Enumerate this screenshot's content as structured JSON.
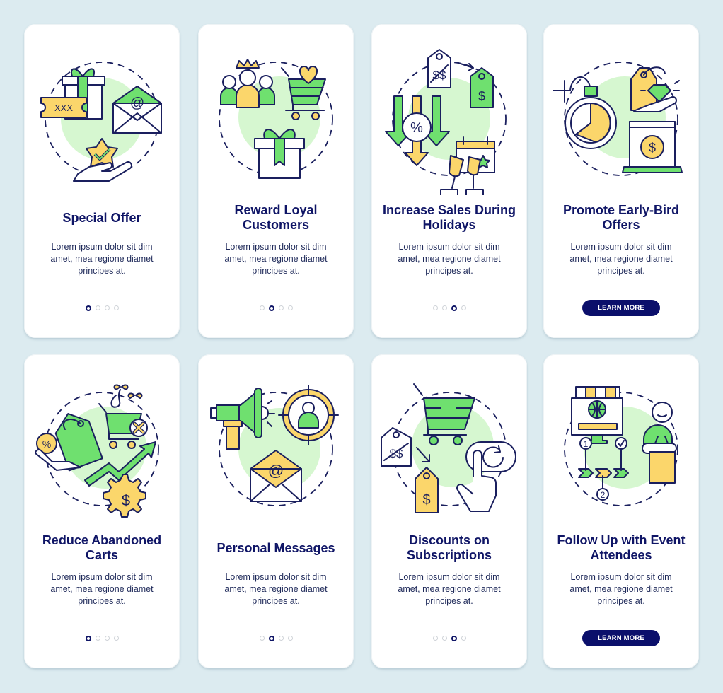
{
  "colors": {
    "background": "#dcebf0",
    "card": "#ffffff",
    "title": "#0f1566",
    "button": "#0b0f6b",
    "accent_green": "#6fe06f",
    "accent_yellow": "#fbd66b",
    "blob_green": "#d6f7d0"
  },
  "screens": [
    {
      "title": "Special Offer",
      "description": "Lorem ipsum dolor sit dim amet, mea regione diamet principes at.",
      "illustration": "special-offer-illustration",
      "active_page": 1,
      "total_pages": 4
    },
    {
      "title": "Reward Loyal Customers",
      "description": "Lorem ipsum dolor sit dim amet, mea regione diamet principes at.",
      "illustration": "reward-loyal-customers-illustration",
      "active_page": 2,
      "total_pages": 4
    },
    {
      "title": "Increase Sales During Holidays",
      "description": "Lorem ipsum dolor sit dim amet, mea regione diamet principes at.",
      "illustration": "holiday-sales-illustration",
      "active_page": 3,
      "total_pages": 4
    },
    {
      "title": "Promote Early-Bird Offers",
      "description": "Lorem ipsum dolor sit dim amet, mea regione diamet principes at.",
      "illustration": "early-bird-illustration",
      "button_label": "LEARN MORE"
    },
    {
      "title": "Reduce Abandoned Carts",
      "description": "Lorem ipsum dolor sit dim amet, mea regione diamet principes at.",
      "illustration": "abandoned-carts-illustration",
      "active_page": 1,
      "total_pages": 4
    },
    {
      "title": "Personal Messages",
      "description": "Lorem ipsum dolor sit dim amet, mea regione diamet principes at.",
      "illustration": "personal-messages-illustration",
      "active_page": 2,
      "total_pages": 4
    },
    {
      "title": "Discounts on Subscriptions",
      "description": "Lorem ipsum dolor sit dim amet, mea regione diamet principes at.",
      "illustration": "subscription-discounts-illustration",
      "active_page": 3,
      "total_pages": 4
    },
    {
      "title": "Follow Up with Event Attendees",
      "description": "Lorem ipsum dolor sit dim amet, mea regione diamet principes at.",
      "illustration": "event-attendees-illustration",
      "button_label": "LEARN MORE"
    }
  ],
  "icon_labels": {
    "ticket": "XXX",
    "at_sign": "@",
    "percent": "%",
    "dollar": "$",
    "crossed_price": "$$",
    "step_1": "1",
    "step_2": "2"
  }
}
